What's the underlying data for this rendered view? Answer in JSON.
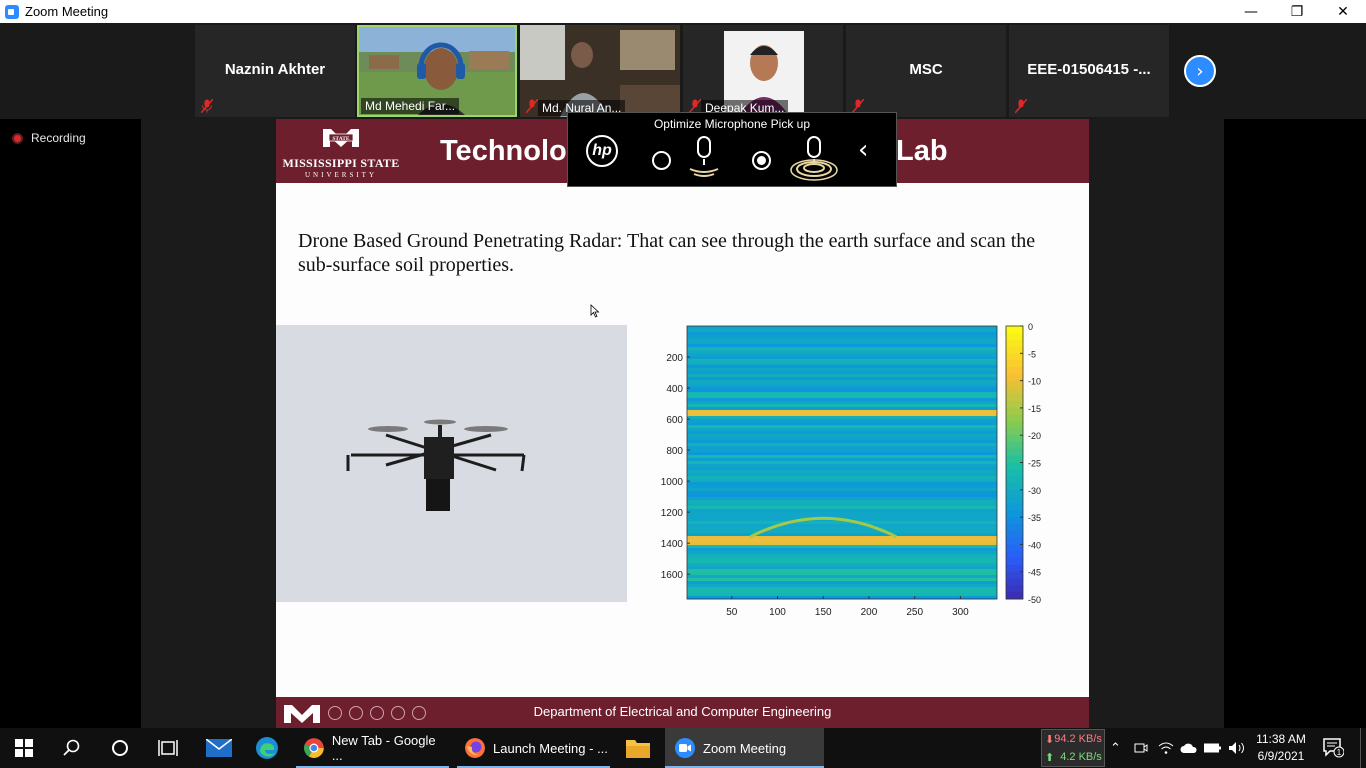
{
  "window": {
    "title": "Zoom Meeting",
    "minimize": "—",
    "restore": "❐",
    "close": "✕"
  },
  "gallery": {
    "participants": [
      {
        "name": "Naznin Akhter",
        "muted": true,
        "video": false
      },
      {
        "name": "Md Mehedi Far...",
        "muted": false,
        "video": true,
        "active": true
      },
      {
        "name": "Md. Nural An...",
        "muted": true,
        "video": true
      },
      {
        "name": "Deepak Kum...",
        "muted": true,
        "video": true
      },
      {
        "name": "MSC",
        "muted": true,
        "video": false
      },
      {
        "name": "EEE-01506415 -...",
        "muted": true,
        "video": false
      }
    ],
    "next_icon": "chevron-right-icon"
  },
  "recording": {
    "label": "Recording"
  },
  "slide": {
    "logo_line1": "MISSISSIPPI STATE",
    "logo_line2": "UNIVERSITY",
    "logo_badge": "STATE",
    "title_visible_left": "Technolog",
    "title_visible_right": "Lab",
    "body": "Drone Based Ground Penetrating Radar: That can see through the earth surface and scan the sub-surface soil properties.",
    "footer": "Department of Electrical and Computer Engineering",
    "colors": {
      "maroon": "#6e1f2e"
    }
  },
  "chart_data": {
    "type": "heatmap",
    "title": "",
    "xlabel": "",
    "ylabel": "",
    "x_ticks": [
      50,
      100,
      150,
      200,
      250,
      300
    ],
    "y_ticks": [
      200,
      400,
      600,
      800,
      1000,
      1200,
      1400,
      1600
    ],
    "xlim": [
      1,
      340
    ],
    "ylim": [
      0,
      1760
    ],
    "y_reversed": true,
    "colorbar": {
      "ticks": [
        0,
        -5,
        -10,
        -15,
        -20,
        -25,
        -30,
        -35,
        -40,
        -45,
        -50
      ],
      "range": [
        -50,
        0
      ],
      "colormap": "parula"
    },
    "features": [
      {
        "kind": "horizontal-band",
        "depth": 560,
        "level": -8
      },
      {
        "kind": "horizontal-band",
        "depth": 1380,
        "level": -12
      },
      {
        "kind": "hyperbola",
        "apex_x": 150,
        "apex_depth": 1240,
        "level": -15
      }
    ]
  },
  "hp_popup": {
    "header": "Optimize Microphone Pick up",
    "logo_text": "hp",
    "options": [
      {
        "icon": "microphone-focused-icon",
        "selected": false
      },
      {
        "icon": "microphone-surround-icon",
        "selected": true
      }
    ],
    "back_icon": "chevron-left-icon"
  },
  "taskbar": {
    "apps": [
      {
        "label": "New Tab - Google ...",
        "icon": "chrome-icon",
        "color": "#e8453c"
      },
      {
        "label": "Launch Meeting - ...",
        "icon": "firefox-icon",
        "color": "#ff7139"
      },
      {
        "label": "Zoom Meeting",
        "icon": "zoom-icon",
        "color": "#2d8cff"
      }
    ],
    "net_down": "94.2 KB/s",
    "net_up": "4.2 KB/s",
    "time": "11:38 AM",
    "date": "6/9/2021",
    "notification_count": "1"
  }
}
